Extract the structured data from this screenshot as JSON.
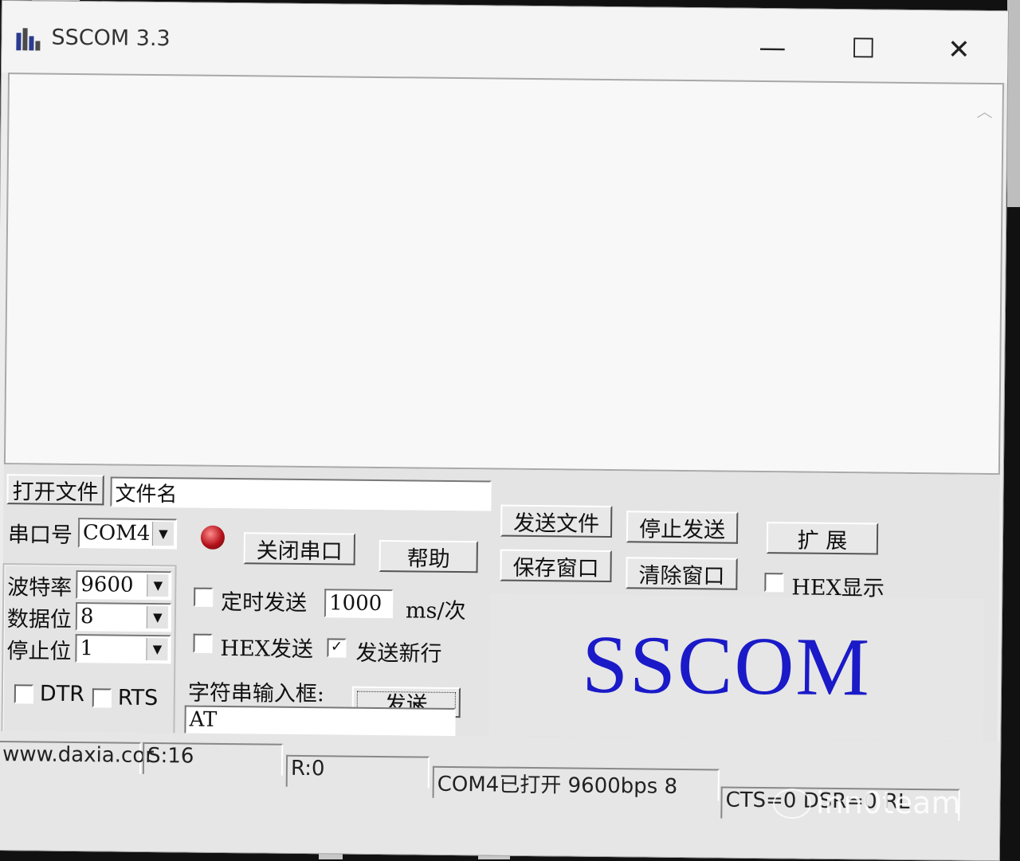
{
  "window": {
    "title": "SSCOM 3.3",
    "controls": {
      "minimize": "—",
      "maximize": "☐",
      "close": "✕"
    }
  },
  "file": {
    "open_file_button": "打开文件",
    "filename_value": "文件名",
    "send_file_button": "发送文件",
    "stop_send_button": "停止发送",
    "extend_button": "扩 展",
    "save_window_button": "保存窗口",
    "clear_window_button": "清除窗口",
    "hex_display_label": "HEX显示",
    "hex_display_checked": false
  },
  "port": {
    "port_label": "串口号",
    "port_value": "COM4",
    "close_port_button": "关闭串口",
    "help_button": "帮助",
    "led_color": "#b5121b"
  },
  "settings": {
    "baud_label": "波特率",
    "baud_value": "9600",
    "databits_label": "数据位",
    "databits_value": "8",
    "stopbits_label": "停止位",
    "stopbits_value": "1",
    "dtr_label": "DTR",
    "rts_label": "RTS",
    "dtr_checked": false,
    "rts_checked": false
  },
  "send": {
    "timed_send_label": "定时发送",
    "timed_send_checked": false,
    "interval_value": "1000",
    "interval_unit": "ms/次",
    "hex_send_label": "HEX发送",
    "hex_send_checked": false,
    "send_newline_label": "发送新行",
    "send_newline_checked": true,
    "input_label": "字符串输入框:",
    "send_button": "发送",
    "input_value": "AT"
  },
  "logo": {
    "text": "SSCOM",
    "color": "#1a1ac8"
  },
  "status": {
    "website": "www.daxia.cor",
    "sent": "S:16",
    "received": "R:0",
    "port_state": "COM4已打开  9600bps  8",
    "signals": "CTS=0 DSR=0 RL"
  },
  "watermark": {
    "text": "inn0team"
  }
}
